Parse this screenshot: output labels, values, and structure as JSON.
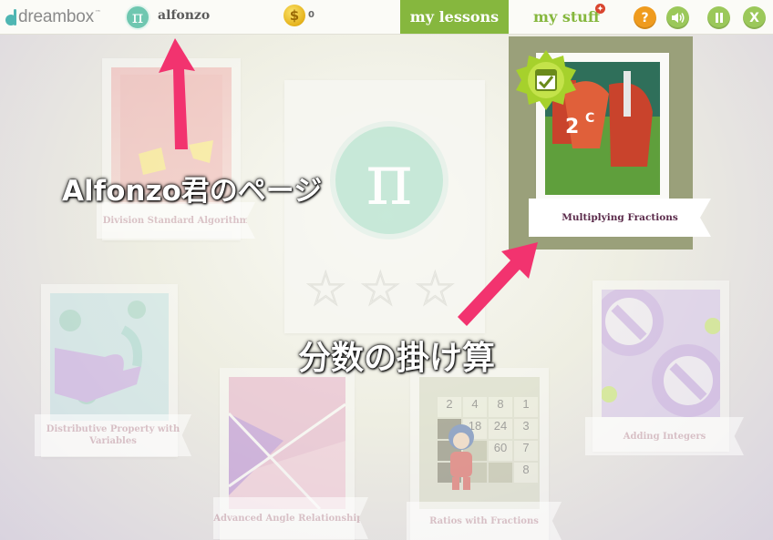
{
  "header": {
    "brand": "dreambox",
    "trademark": "™",
    "avatar_glyph": "π",
    "username": "alfonzo",
    "coin_glyph": "$",
    "coins": "0",
    "tabs": [
      {
        "label": "my lessons",
        "active": true
      },
      {
        "label": "my stuff",
        "badge": "✦"
      }
    ],
    "controls": [
      {
        "name": "help",
        "glyph": "?"
      },
      {
        "name": "sound",
        "glyph": "🔊"
      },
      {
        "name": "pause",
        "glyph": "❚❚"
      },
      {
        "name": "close",
        "glyph": "X"
      }
    ]
  },
  "lessons": [
    {
      "title": "Division Standard Algorithm",
      "state": "faded"
    },
    {
      "title": "Multiplying Fractions",
      "state": "completed",
      "badge_icon": "calendar-check-icon"
    },
    {
      "title": "Distributive Property with Variables",
      "state": "faded"
    },
    {
      "title": "Advanced Angle Relationships",
      "state": "faded"
    },
    {
      "title": "Ratios with Fractions",
      "state": "faded",
      "grid_numbers": [
        "2",
        "4",
        "8",
        "1",
        "18",
        "24",
        "3",
        "60",
        "7",
        "8"
      ]
    },
    {
      "title": "Adding Integers",
      "state": "faded"
    }
  ],
  "center": {
    "glyph": "π",
    "stars": [
      "☆",
      "☆",
      "☆"
    ]
  },
  "annotations": {
    "page_label": "Alfonzo君のページ",
    "lesson_label": "分数の掛け算"
  },
  "colors": {
    "brand_teal": "#4fb6b3",
    "tab_green": "#86b73e",
    "help_orange": "#ef9b1e",
    "annotation_pink": "#f2336f"
  }
}
